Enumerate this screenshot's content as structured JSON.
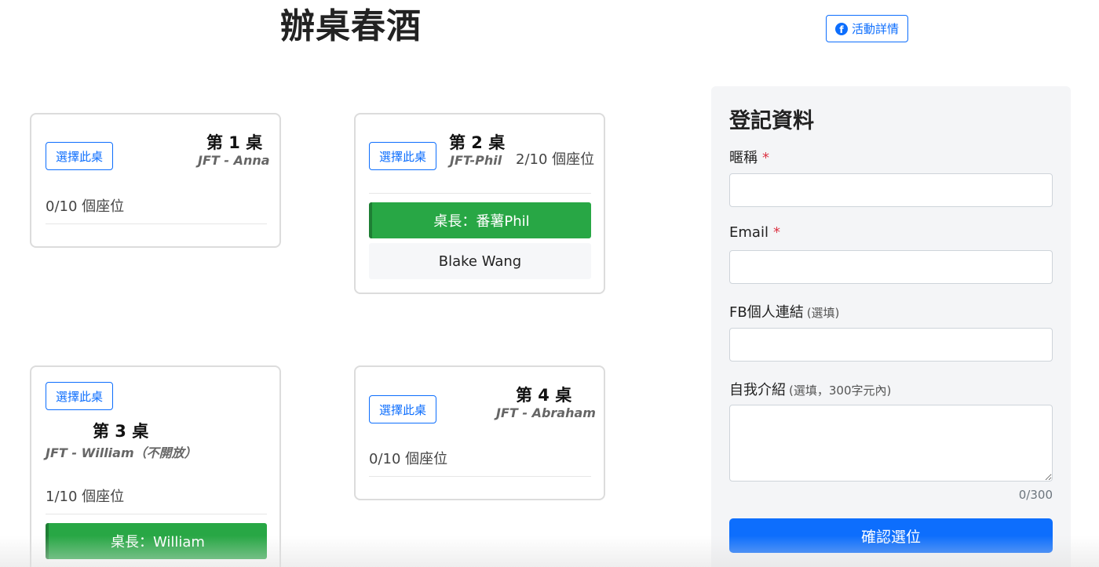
{
  "page_title": "辦桌春酒",
  "event_button": {
    "label": "活動詳情",
    "icon": "facebook-icon"
  },
  "tables": [
    {
      "title": "第 1 桌",
      "host": "JFT - Anna",
      "seats": "0/10 個座位",
      "select_label": "選擇此桌",
      "members": []
    },
    {
      "title": "第 2 桌",
      "host": "JFT-Phil",
      "seats": "2/10 個座位",
      "select_label": "選擇此桌",
      "host_bar": "桌長：番薯Phil",
      "members": [
        "Blake Wang"
      ]
    },
    {
      "title": "第 3 桌",
      "host": "JFT - William（不開放）",
      "seats": "1/10 個座位",
      "select_label": "選擇此桌",
      "host_bar": "桌長：William",
      "members": []
    },
    {
      "title": "第 4 桌",
      "host": "JFT - Abraham",
      "seats": "0/10 個座位",
      "select_label": "選擇此桌",
      "members": []
    }
  ],
  "form": {
    "heading": "登記資料",
    "nickname": {
      "label": "暱稱",
      "required_mark": "*",
      "value": ""
    },
    "email": {
      "label": "Email",
      "required_mark": "*",
      "value": ""
    },
    "fb_link": {
      "label": "FB個人連結",
      "hint": "(選填)",
      "value": ""
    },
    "intro": {
      "label": "自我介紹",
      "hint": "(選填，300字元內)",
      "value": "",
      "counter": "0/300"
    },
    "submit_label": "確認選位"
  },
  "colors": {
    "primary": "#0d6efd",
    "success": "#28a745",
    "required": "#dc3545",
    "panel_bg": "#f4f5f7"
  }
}
